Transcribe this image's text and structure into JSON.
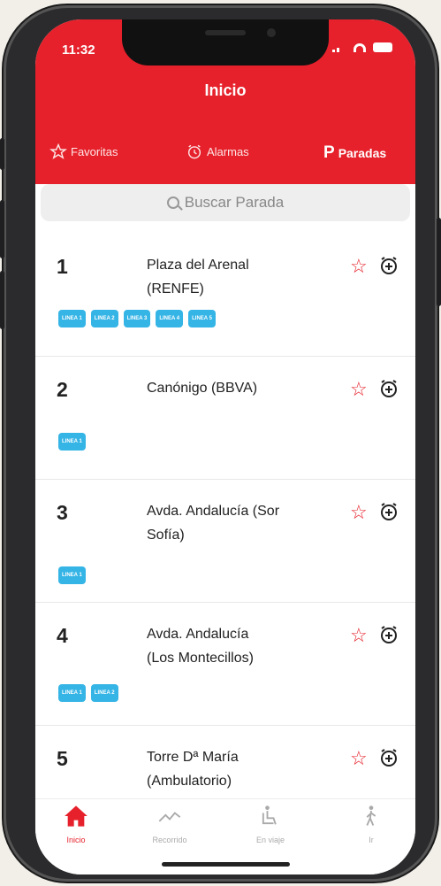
{
  "status_bar": {
    "time": "11:32"
  },
  "header": {
    "title": "Inicio"
  },
  "tabs": [
    {
      "label": "Favoritas",
      "icon": "star-outline-icon"
    },
    {
      "label": "Alarmas",
      "icon": "alarm-clock-icon"
    },
    {
      "label": "Paradas",
      "icon": "parking-p-icon",
      "glyph": "P",
      "active": true
    }
  ],
  "search": {
    "placeholder": "Buscar Parada"
  },
  "stops": [
    {
      "number": "1",
      "name_line1": "Plaza del Arenal",
      "name_line2": "(RENFE)",
      "lines": [
        "LINEA 1",
        "LINEA 2",
        "LINEA 3",
        "LINEA 4",
        "LINEA 5"
      ]
    },
    {
      "number": "2",
      "name_line1": "Canónigo (BBVA)",
      "name_line2": "",
      "lines": [
        "LINEA 1"
      ]
    },
    {
      "number": "3",
      "name_line1": "Avda. Andalucía (Sor",
      "name_line2": "Sofía)",
      "lines": [
        "LINEA 1"
      ]
    },
    {
      "number": "4",
      "name_line1": "Avda. Andalucía",
      "name_line2": "(Los Montecillos)",
      "lines": [
        "LINEA 1",
        "LINEA 2"
      ]
    },
    {
      "number": "5",
      "name_line1": "Torre Dª María",
      "name_line2": "(Ambulatorio)",
      "lines": []
    }
  ],
  "bottom_nav": [
    {
      "label": "Inicio",
      "icon": "home-icon",
      "active": true
    },
    {
      "label": "Recorrido",
      "icon": "route-line-icon"
    },
    {
      "label": "En viaje",
      "icon": "seated-passenger-icon"
    },
    {
      "label": "Ir",
      "icon": "walking-person-icon"
    }
  ],
  "colors": {
    "accent": "#e6212b",
    "badge": "#35b4e6"
  }
}
